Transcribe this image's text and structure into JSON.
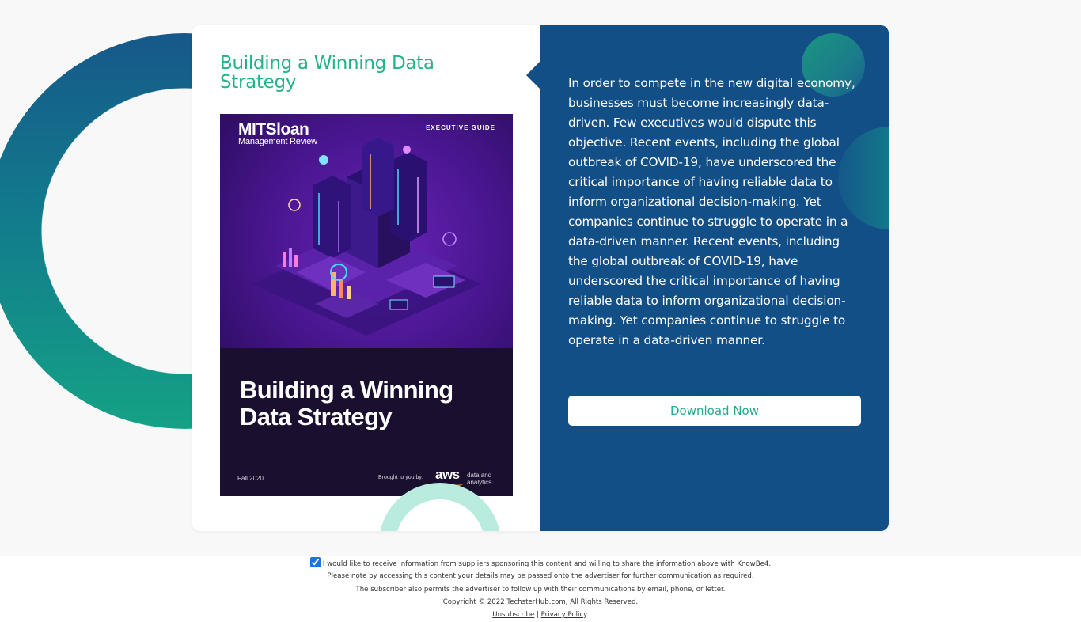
{
  "card": {
    "title": "Building a Winning Data Strategy",
    "description": "In order to compete in the new digital economy, businesses must become increasingly data-driven. Few executives would dispute this objective. Recent events, including the global outbreak of COVID-19, have underscored the critical importance of having reliable data to inform organizational decision-making. Yet companies continue to struggle to operate in a data-driven manner. Recent events, including the global outbreak of COVID-19, have underscored the critical importance of having reliable data to inform organizational decision-making. Yet companies continue to struggle to operate in a data-driven manner.",
    "download_label": "Download Now"
  },
  "cover": {
    "publisher_line1": "MITSloan",
    "publisher_line2": "Management Review",
    "label": "EXECUTIVE GUIDE",
    "title": "Building a Winning Data Strategy",
    "season": "Fall 2020",
    "brought_by": "Brought to you by:",
    "sponsor_mark": "aws",
    "sponsor_text": "data and analytics"
  },
  "footer": {
    "consent_checked": true,
    "consent_text": "I would like to receive information from suppliers sponsoring this content and willing to share the information above with KnowBe4.",
    "note_line1": "Please note by accessing this content your details may be passed onto the advertiser for further communication as required.",
    "note_line2": "The subscriber also permits the advertiser to follow up with their communications by email, phone, or letter.",
    "copyright": "Copyright © 2022 TechsterHub.com, All Rights Reserved.",
    "unsubscribe": "Unsubscribe",
    "separator": "|",
    "privacy": "Privacy Policy",
    "trailing": "."
  },
  "colors": {
    "title_green": "#22b389",
    "panel_blue": "#134f87",
    "button_text": "#26a891"
  }
}
